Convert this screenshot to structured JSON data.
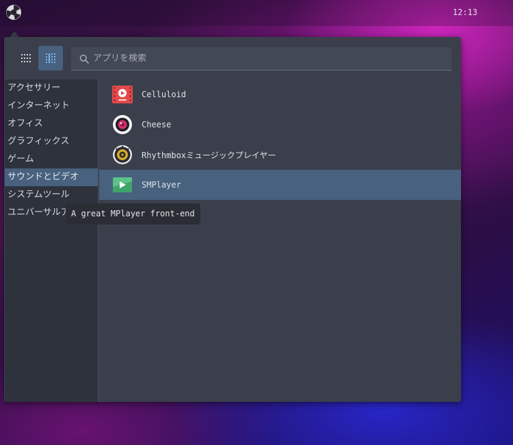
{
  "panel": {
    "clock": "12:13",
    "start_icon": "distro-logo-icon"
  },
  "menu": {
    "view_buttons": [
      {
        "icon": "grid-view-icon",
        "active": false
      },
      {
        "icon": "list-view-icon",
        "active": true
      }
    ],
    "search": {
      "placeholder": "アプリを検索",
      "value": ""
    },
    "categories": [
      {
        "label": "アクセサリー",
        "selected": false
      },
      {
        "label": "インターネット",
        "selected": false
      },
      {
        "label": "オフィス",
        "selected": false
      },
      {
        "label": "グラフィックス",
        "selected": false
      },
      {
        "label": "ゲーム",
        "selected": false
      },
      {
        "label": "サウンドとビデオ",
        "selected": true
      },
      {
        "label": "システムツール",
        "selected": false
      },
      {
        "label": "ユニバーサルアクセス",
        "selected": false
      }
    ],
    "apps": [
      {
        "name": "Celluloid",
        "icon": "celluloid-icon",
        "selected": false
      },
      {
        "name": "Cheese",
        "icon": "cheese-icon",
        "selected": false
      },
      {
        "name": "Rhythmboxミュージックプレイヤー",
        "icon": "rhythmbox-icon",
        "selected": false
      },
      {
        "name": "SMPlayer",
        "icon": "smplayer-icon",
        "selected": true
      }
    ],
    "tooltip": "A great MPlayer front-end"
  },
  "colors": {
    "menu_bg": "#3a3f4b",
    "sidebar_bg": "#2e323c",
    "selection": "#47617e"
  }
}
